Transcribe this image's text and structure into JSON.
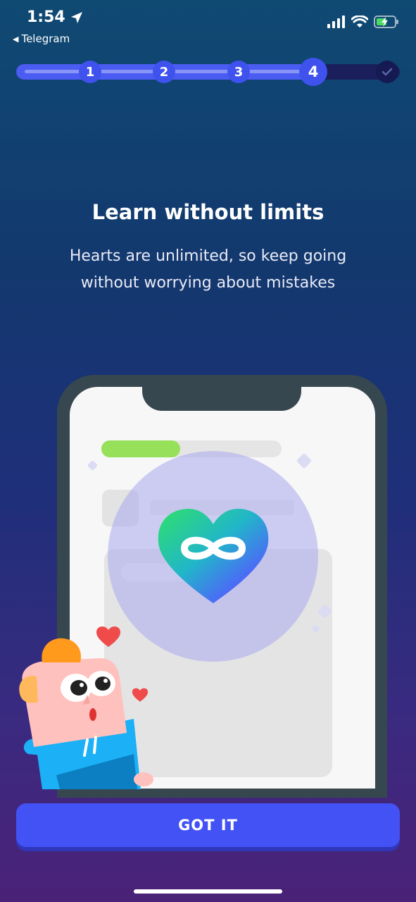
{
  "status_bar": {
    "time": "1:54",
    "back_app": "Telegram",
    "icons": [
      "location-arrow-icon",
      "signal-icon",
      "wifi-icon",
      "battery-charging-icon"
    ]
  },
  "progress": {
    "steps": [
      "1",
      "2",
      "3",
      "4"
    ],
    "current_step": 4,
    "final_icon": "checkmark-icon"
  },
  "content": {
    "title": "Learn without limits",
    "subtitle": "Hearts are unlimited, so keep going without worrying about mistakes"
  },
  "illustration": {
    "center_icon": "infinity-heart-icon",
    "accent_color": "#4352f5"
  },
  "actions": {
    "got_it": "GOT IT"
  }
}
